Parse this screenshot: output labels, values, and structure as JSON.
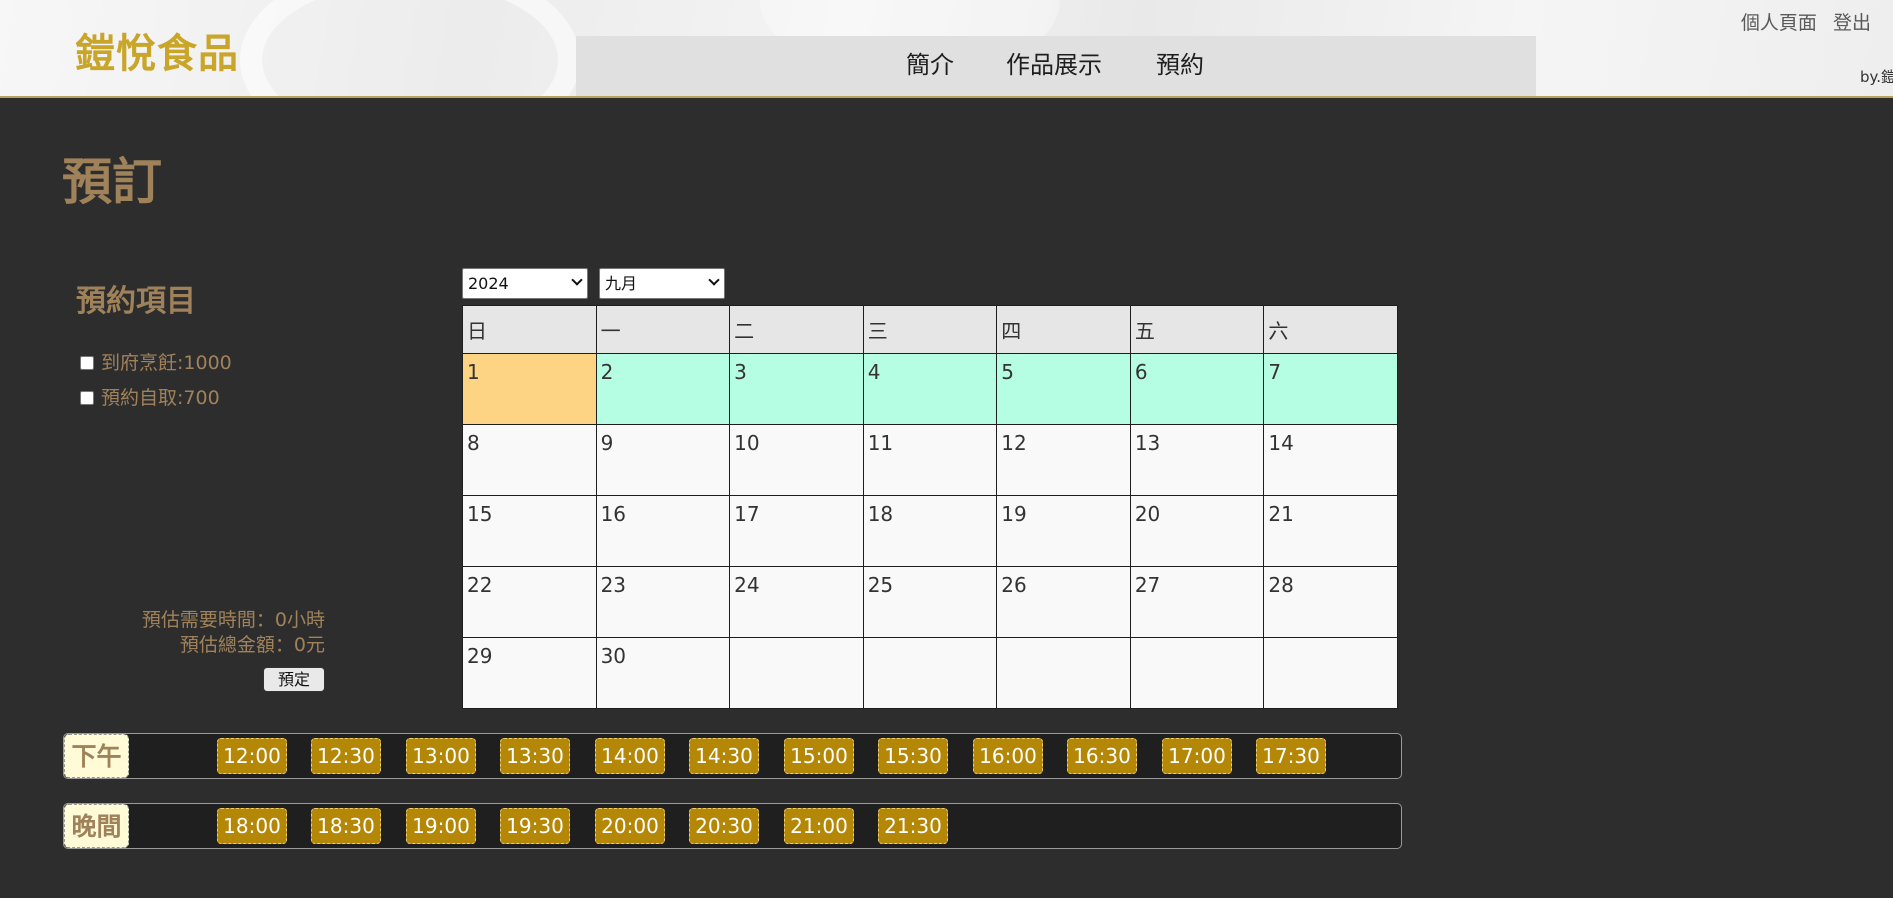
{
  "header": {
    "logo": "鎧悅食品",
    "nav": [
      "簡介",
      "作品展示",
      "預約"
    ],
    "user_links": [
      "個人頁面",
      "登出"
    ],
    "byline": "by.鎧"
  },
  "page_title": "預訂",
  "booking_items": {
    "title": "預約項目",
    "options": [
      {
        "label": "到府烹飪:1000",
        "checked": false
      },
      {
        "label": "預約自取:700",
        "checked": false
      }
    ]
  },
  "estimate": {
    "time": "預估需要時間：0小時",
    "total": "預估總金額：0元",
    "button": "預定"
  },
  "calendar": {
    "year": "2024",
    "month": "九月",
    "weekdays": [
      "日",
      "一",
      "二",
      "三",
      "四",
      "五",
      "六"
    ],
    "weeks": [
      [
        "1",
        "2",
        "3",
        "4",
        "5",
        "6",
        "7"
      ],
      [
        "8",
        "9",
        "10",
        "11",
        "12",
        "13",
        "14"
      ],
      [
        "15",
        "16",
        "17",
        "18",
        "19",
        "20",
        "21"
      ],
      [
        "22",
        "23",
        "24",
        "25",
        "26",
        "27",
        "28"
      ],
      [
        "29",
        "30",
        "",
        "",
        "",
        "",
        ""
      ]
    ],
    "colors": {
      "today": "#fdd384",
      "highlight_week": "#b5fde3"
    }
  },
  "time_slots": {
    "afternoon": {
      "label": "下午",
      "times": [
        "12:00",
        "12:30",
        "13:00",
        "13:30",
        "14:00",
        "14:30",
        "15:00",
        "15:30",
        "16:00",
        "16:30",
        "17:00",
        "17:30"
      ]
    },
    "evening": {
      "label": "晚間",
      "times": [
        "18:00",
        "18:30",
        "19:00",
        "19:30",
        "20:00",
        "20:30",
        "21:00",
        "21:30"
      ]
    },
    "slot_color": "#b58706"
  }
}
